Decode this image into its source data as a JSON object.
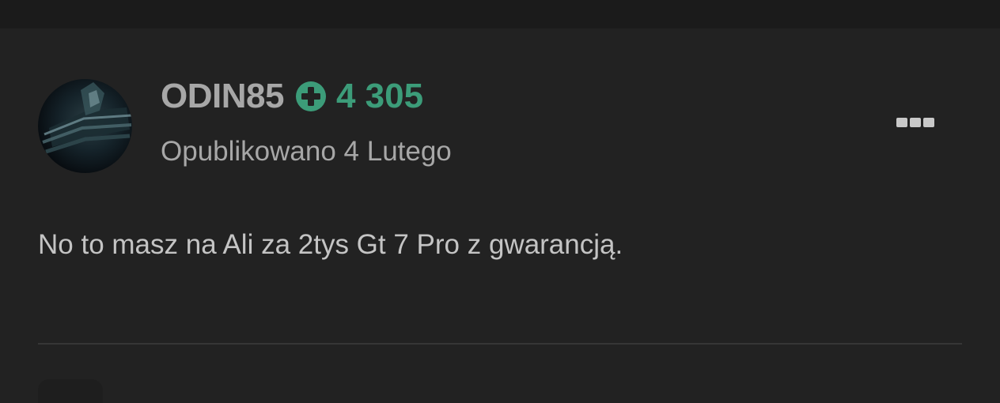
{
  "post": {
    "author": {
      "username": "ODIN85",
      "reputation": "4 305",
      "avatar_icon": "user-avatar"
    },
    "posted_date": "Opublikowano 4 Lutego",
    "content": "No to masz na Ali za 2tys Gt 7 Pro z gwarancją.",
    "menu_icon": "more-options-icon"
  },
  "colors": {
    "background": "#222222",
    "reputation_accent": "#3c9c79",
    "text_muted": "#a7a7a7"
  }
}
